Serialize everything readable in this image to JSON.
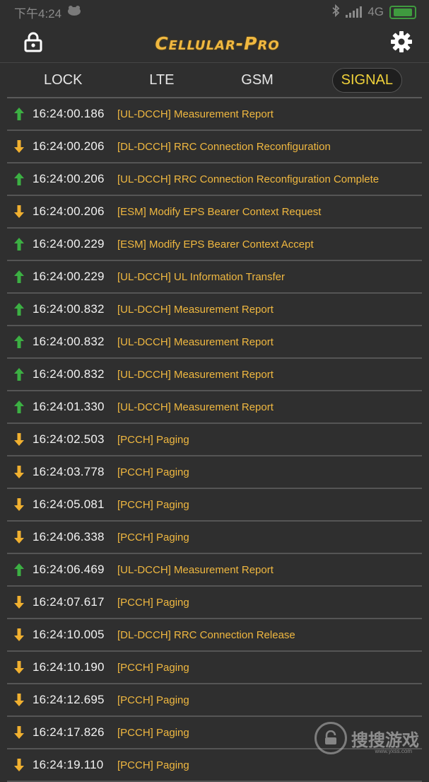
{
  "status_bar": {
    "time": "下午4:24",
    "network": "4G"
  },
  "header": {
    "title": "Cellular-Pro"
  },
  "tabs": [
    {
      "label": "LOCK",
      "active": false
    },
    {
      "label": "LTE",
      "active": false
    },
    {
      "label": "GSM",
      "active": false
    },
    {
      "label": "SIGNAL",
      "active": true
    }
  ],
  "log": [
    {
      "dir": "up",
      "time": "16:24:00.186",
      "msg": "[UL-DCCH] Measurement Report"
    },
    {
      "dir": "down",
      "time": "16:24:00.206",
      "msg": "[DL-DCCH] RRC Connection Reconfiguration"
    },
    {
      "dir": "up",
      "time": "16:24:00.206",
      "msg": "[UL-DCCH] RRC Connection Reconfiguration Complete"
    },
    {
      "dir": "down",
      "time": "16:24:00.206",
      "msg": "[ESM] Modify EPS Bearer Context Request"
    },
    {
      "dir": "up",
      "time": "16:24:00.229",
      "msg": "[ESM] Modify EPS Bearer Context Accept"
    },
    {
      "dir": "up",
      "time": "16:24:00.229",
      "msg": "[UL-DCCH] UL Information Transfer"
    },
    {
      "dir": "up",
      "time": "16:24:00.832",
      "msg": "[UL-DCCH] Measurement Report"
    },
    {
      "dir": "up",
      "time": "16:24:00.832",
      "msg": "[UL-DCCH] Measurement Report"
    },
    {
      "dir": "up",
      "time": "16:24:00.832",
      "msg": "[UL-DCCH] Measurement Report"
    },
    {
      "dir": "up",
      "time": "16:24:01.330",
      "msg": "[UL-DCCH] Measurement Report"
    },
    {
      "dir": "down",
      "time": "16:24:02.503",
      "msg": "[PCCH] Paging"
    },
    {
      "dir": "down",
      "time": "16:24:03.778",
      "msg": "[PCCH] Paging"
    },
    {
      "dir": "down",
      "time": "16:24:05.081",
      "msg": "[PCCH] Paging"
    },
    {
      "dir": "down",
      "time": "16:24:06.338",
      "msg": "[PCCH] Paging"
    },
    {
      "dir": "up",
      "time": "16:24:06.469",
      "msg": "[UL-DCCH] Measurement Report"
    },
    {
      "dir": "down",
      "time": "16:24:07.617",
      "msg": "[PCCH] Paging"
    },
    {
      "dir": "down",
      "time": "16:24:10.005",
      "msg": "[DL-DCCH] RRC Connection Release"
    },
    {
      "dir": "down",
      "time": "16:24:10.190",
      "msg": "[PCCH] Paging"
    },
    {
      "dir": "down",
      "time": "16:24:12.695",
      "msg": "[PCCH] Paging"
    },
    {
      "dir": "down",
      "time": "16:24:17.826",
      "msg": "[PCCH] Paging"
    },
    {
      "dir": "down",
      "time": "16:24:19.110",
      "msg": "[PCCH] Paging"
    }
  ],
  "colors": {
    "up": "#3cb043",
    "down": "#f0b030",
    "accent": "#f0b840",
    "active_tab": "#f0d23a"
  },
  "icons": {
    "lock": "lock-icon",
    "settings": "gear-icon",
    "up": "arrow-up-icon",
    "down": "arrow-down-icon"
  },
  "watermark": {
    "text": "搜搜游戏",
    "sub": "www.yxss.com"
  }
}
